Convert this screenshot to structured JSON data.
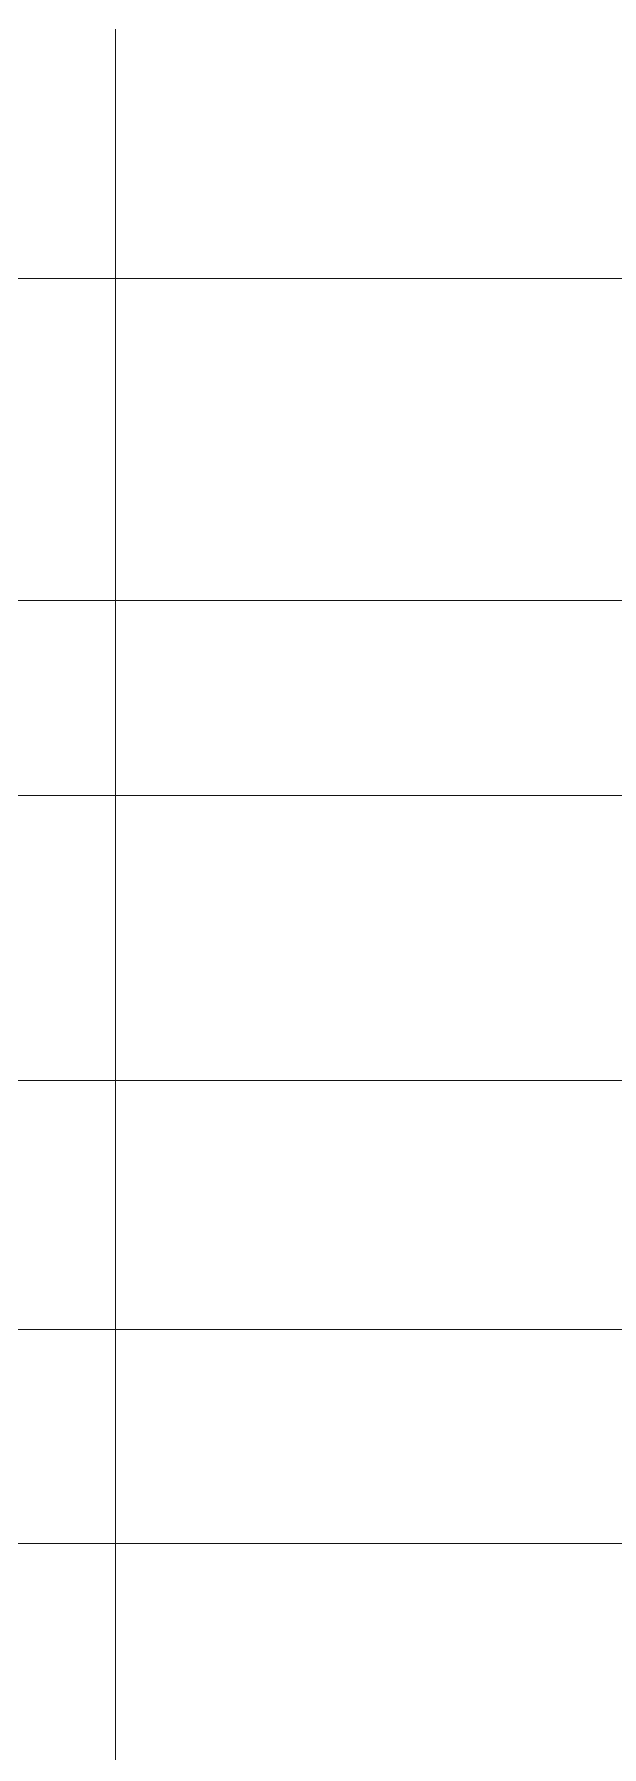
{
  "table": {
    "rows": [
      {
        "label": "",
        "content": ""
      },
      {
        "label": "",
        "content": ""
      },
      {
        "label": "",
        "content": ""
      },
      {
        "label": "",
        "content": ""
      },
      {
        "label": "",
        "content": ""
      },
      {
        "label": "",
        "content": ""
      },
      {
        "label": "",
        "content": ""
      }
    ]
  },
  "colors": {
    "background": "#ffffff",
    "rule": "#111111"
  }
}
